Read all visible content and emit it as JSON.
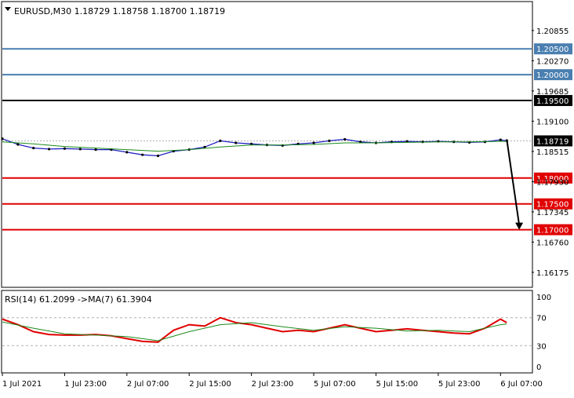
{
  "chart_data": [
    {
      "type": "line",
      "title": "EURUSD,M30  1.18729 1.18758 1.18700 1.18719",
      "symbol": "EURUSD,M30",
      "ohlc": {
        "open": "1.18729",
        "high": "1.18758",
        "low": "1.18700",
        "close": "1.18719"
      },
      "ylim": [
        1.159,
        1.214
      ],
      "y_ticks": [
        "1.20855",
        "1.20270",
        "1.19685",
        "1.19100",
        "1.18515",
        "1.17930",
        "1.17345",
        "1.16760",
        "1.16175"
      ],
      "current_price": {
        "label": "1.18719",
        "value": 1.18719
      },
      "horizontal_levels": [
        {
          "label": "1.20500",
          "value": 1.205,
          "color": "#4a7fb0"
        },
        {
          "label": "1.20000",
          "value": 1.2,
          "color": "#4a7fb0"
        },
        {
          "label": "1.19500",
          "value": 1.195,
          "color": "#000000"
        },
        {
          "label": "1.18000",
          "value": 1.18,
          "color": "#e00000"
        },
        {
          "label": "1.17500",
          "value": 1.175,
          "color": "#e00000"
        },
        {
          "label": "1.17000",
          "value": 1.17,
          "color": "#e00000"
        }
      ],
      "forecast_arrow": {
        "from": {
          "x": 162,
          "y": 1.1875
        },
        "to": {
          "x": 166,
          "y": 1.17
        }
      },
      "x_ticks": [
        {
          "x": 0,
          "label": "1 Jul 2021"
        },
        {
          "x": 20,
          "label": "1 Jul 23:00"
        },
        {
          "x": 40,
          "label": "2 Jul 07:00"
        },
        {
          "x": 60,
          "label": "2 Jul 15:00"
        },
        {
          "x": 80,
          "label": "2 Jul 23:00"
        },
        {
          "x": 100,
          "label": "5 Jul 07:00"
        },
        {
          "x": 120,
          "label": "5 Jul 15:00"
        },
        {
          "x": 140,
          "label": "5 Jul 23:00"
        },
        {
          "x": 160,
          "label": "6 Jul 07:00"
        }
      ],
      "xlim": [
        0,
        170
      ],
      "series": [
        {
          "values_x": [
            0,
            5,
            10,
            15,
            20,
            25,
            30,
            35,
            40,
            45,
            50,
            55,
            60,
            65,
            70,
            75,
            80,
            85,
            90,
            95,
            100,
            105,
            110,
            115,
            120,
            125,
            130,
            135,
            140,
            145,
            150,
            155,
            160,
            162
          ],
          "values": [
            1.1876,
            1.1865,
            1.1858,
            1.1856,
            1.1857,
            1.1856,
            1.1855,
            1.1855,
            1.185,
            1.1845,
            1.1843,
            1.1852,
            1.1855,
            1.186,
            1.1872,
            1.1868,
            1.1866,
            1.1864,
            1.1863,
            1.1866,
            1.1868,
            1.1872,
            1.1875,
            1.187,
            1.1868,
            1.187,
            1.1871,
            1.187,
            1.1871,
            1.187,
            1.1869,
            1.187,
            1.1874,
            1.1872
          ]
        },
        {
          "values_x": [
            0,
            10,
            20,
            30,
            40,
            50,
            60,
            70,
            80,
            90,
            100,
            110,
            120,
            130,
            140,
            150,
            160,
            162
          ],
          "values": [
            1.187,
            1.1866,
            1.1861,
            1.1858,
            1.1855,
            1.1852,
            1.1855,
            1.186,
            1.1864,
            1.1864,
            1.1865,
            1.1868,
            1.1868,
            1.1869,
            1.187,
            1.187,
            1.1871,
            1.1871
          ]
        }
      ]
    },
    {
      "type": "line",
      "title": "RSI(14) 61.2099  ->MA(7) 61.3904",
      "ylim": [
        -8,
        108
      ],
      "y_ticks": [
        "100",
        "70",
        "30",
        "0"
      ],
      "levels": [
        70,
        30
      ],
      "xlim": [
        0,
        170
      ],
      "series": [
        {
          "values_x": [
            0,
            5,
            10,
            15,
            20,
            25,
            30,
            35,
            40,
            45,
            50,
            55,
            60,
            65,
            70,
            75,
            80,
            85,
            90,
            95,
            100,
            105,
            110,
            115,
            120,
            125,
            130,
            135,
            140,
            145,
            150,
            155,
            160,
            162
          ],
          "values": [
            68,
            60,
            50,
            46,
            45,
            45,
            46,
            44,
            40,
            36,
            35,
            52,
            60,
            58,
            70,
            63,
            60,
            55,
            50,
            52,
            50,
            55,
            60,
            55,
            50,
            52,
            54,
            52,
            50,
            48,
            47,
            55,
            68,
            63
          ]
        },
        {
          "values_x": [
            0,
            10,
            20,
            30,
            40,
            50,
            60,
            70,
            80,
            90,
            100,
            110,
            120,
            130,
            140,
            150,
            160,
            162
          ],
          "values": [
            64,
            55,
            47,
            45,
            43,
            37,
            50,
            60,
            63,
            57,
            52,
            57,
            55,
            51,
            52,
            50,
            60,
            61
          ]
        }
      ]
    }
  ]
}
